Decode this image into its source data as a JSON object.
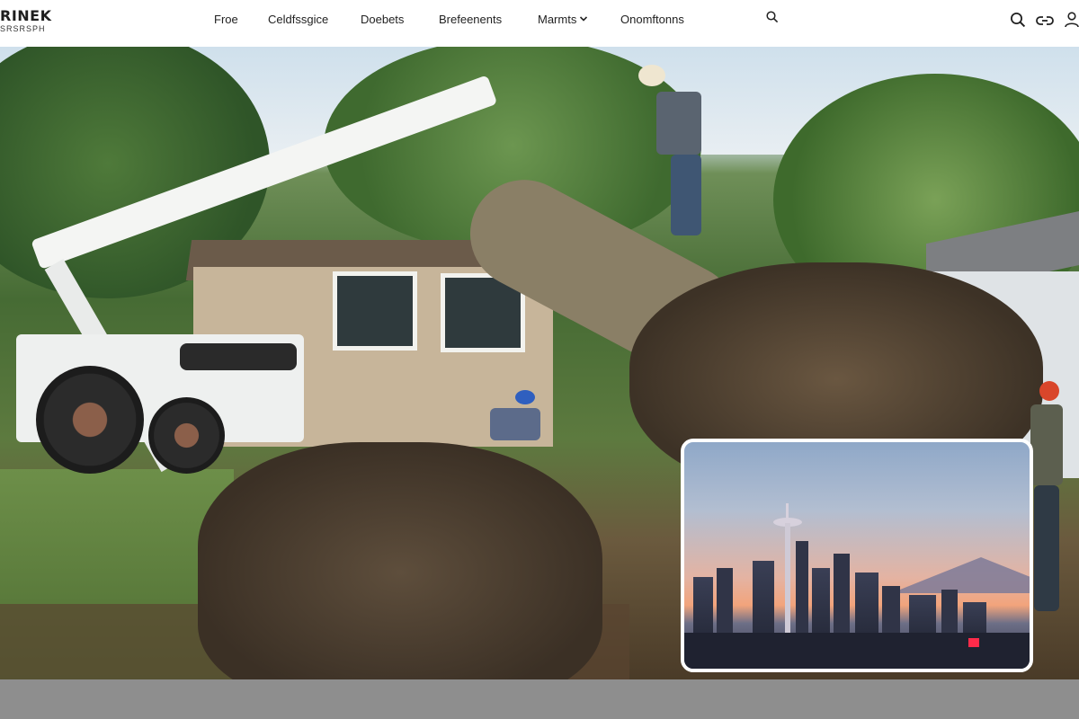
{
  "header": {
    "logo_main": "RINEK",
    "logo_sub": "SRSRSPH",
    "nav": [
      {
        "label": "Froe"
      },
      {
        "label": "Celdfssgice"
      },
      {
        "label": "Doebets"
      },
      {
        "label": "Brefeenents"
      },
      {
        "label": "Marmts",
        "has_dropdown": true
      },
      {
        "label": "Onomftonns"
      }
    ],
    "icons": [
      "search-icon",
      "search-icon",
      "link-icon",
      "user-icon"
    ]
  },
  "hero": {
    "image": "tree-removal-crane-photo"
  },
  "inset": {
    "image": "seattle-skyline-dusk-photo"
  },
  "colors": {
    "header_bg": "#ffffff",
    "bottom_bar": "#8e8e8e",
    "inset_border": "#ffffff"
  }
}
